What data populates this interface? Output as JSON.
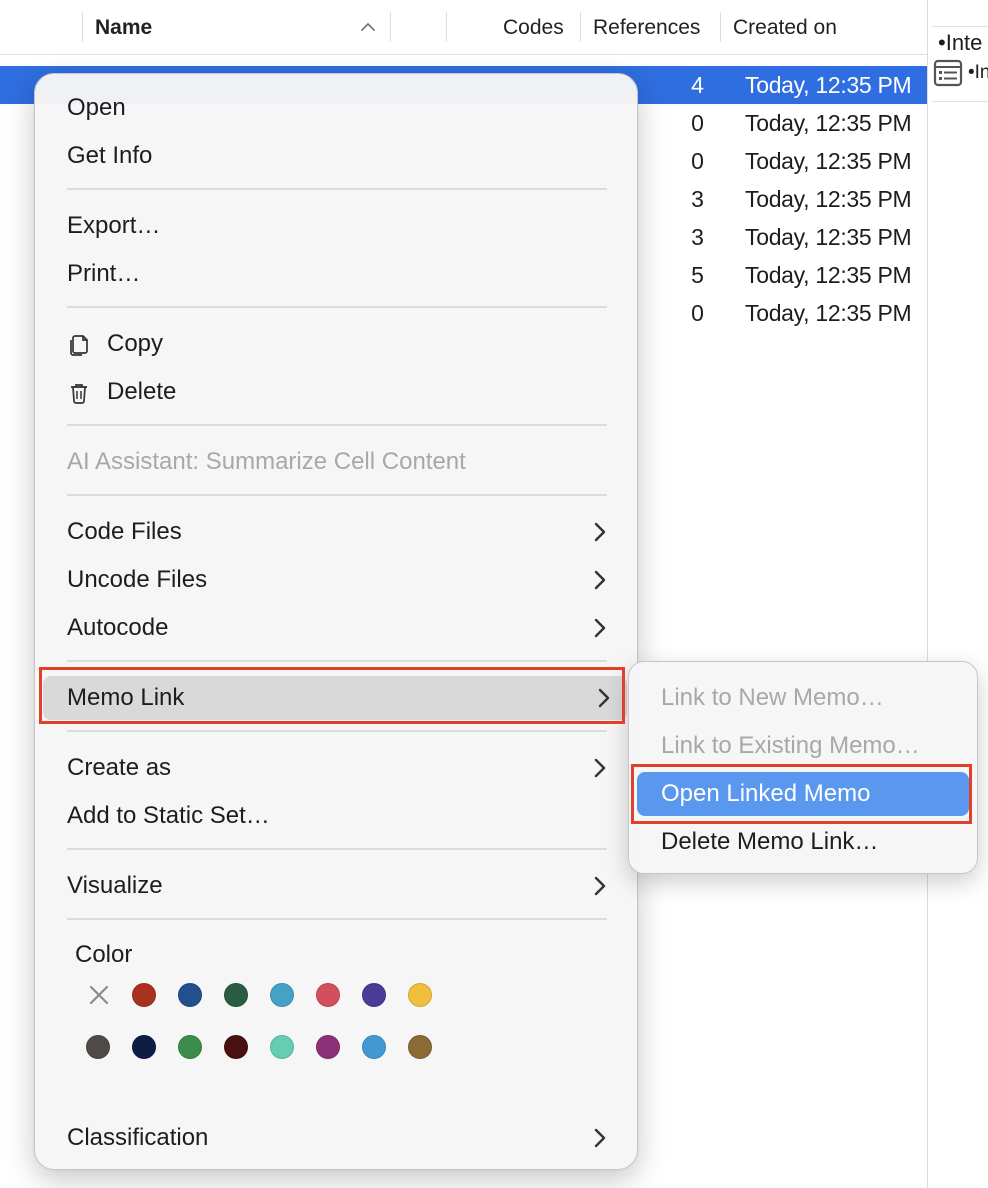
{
  "table": {
    "columns": {
      "name": "Name",
      "codes": "Codes",
      "references": "References",
      "created_on": "Created on"
    },
    "rows": [
      {
        "codes": "4",
        "created": "Today, 12:35 PM",
        "selected": true
      },
      {
        "codes": "0",
        "created": "Today, 12:35 PM"
      },
      {
        "codes": "0",
        "created": "Today, 12:35 PM"
      },
      {
        "codes": "3",
        "created": "Today, 12:35 PM"
      },
      {
        "codes": "3",
        "created": "Today, 12:35 PM"
      },
      {
        "codes": "5",
        "created": "Today, 12:35 PM"
      },
      {
        "codes": "0",
        "created": "Today, 12:35 PM"
      }
    ]
  },
  "side_panel": {
    "line1": "•Inte",
    "line2": "•In"
  },
  "menu": {
    "open": "Open",
    "get_info": "Get Info",
    "export": "Export…",
    "print": "Print…",
    "copy": "Copy",
    "delete": "Delete",
    "ai_assistant": "AI Assistant: Summarize Cell Content",
    "code_files": "Code Files",
    "uncode_files": "Uncode Files",
    "autocode": "Autocode",
    "memo_link": "Memo Link",
    "create_as": "Create as",
    "add_to_static_set": "Add to Static Set…",
    "visualize": "Visualize",
    "color_title": "Color",
    "classification": "Classification"
  },
  "colors": {
    "row1": [
      "#a8321f",
      "#234f8f",
      "#2a5b43",
      "#45a1c5",
      "#d1505c",
      "#4b3b96",
      "#f0bf3c"
    ],
    "row2": [
      "#4f4a47",
      "#0e1c46",
      "#3c8d4b",
      "#48100f",
      "#66cdb3",
      "#8b3179",
      "#4398d3",
      "#8a6a35"
    ]
  },
  "submenu": {
    "link_new": "Link to New Memo…",
    "link_existing": "Link to Existing Memo…",
    "open_linked": "Open Linked Memo",
    "delete_link": "Delete Memo Link…"
  }
}
